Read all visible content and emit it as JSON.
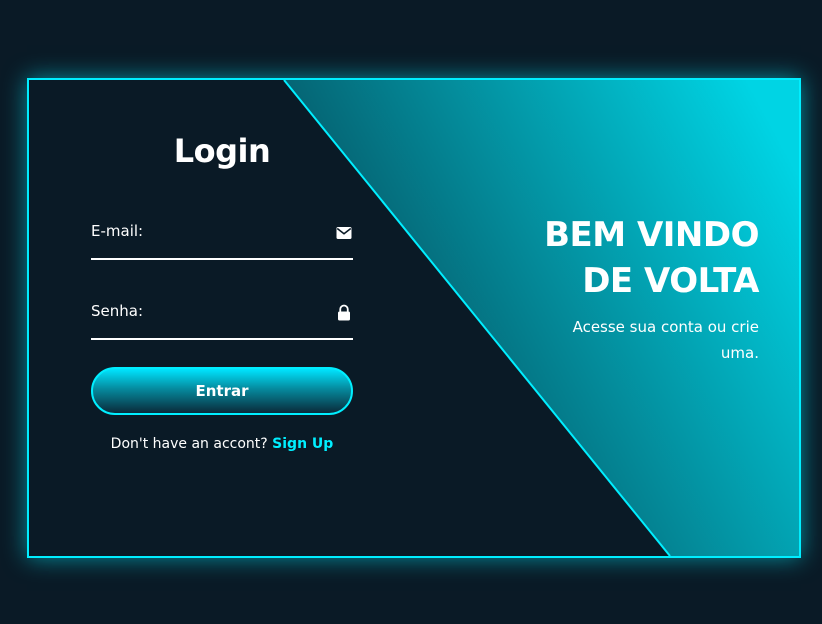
{
  "login": {
    "title": "Login",
    "email_label": "E-mail:",
    "password_label": "Senha:",
    "email_icon": "envelope-icon",
    "password_icon": "lock-icon",
    "submit_label": "Entrar",
    "signup_prompt": "Don't have an accont?",
    "signup_link": "Sign Up"
  },
  "welcome": {
    "title_line1": "BEM VINDO",
    "title_line2": "DE VOLTA",
    "subtitle": "Acesse sua conta ou crie uma."
  },
  "colors": {
    "background": "#0a1a26",
    "accent": "#00eeff",
    "text": "#ffffff"
  }
}
